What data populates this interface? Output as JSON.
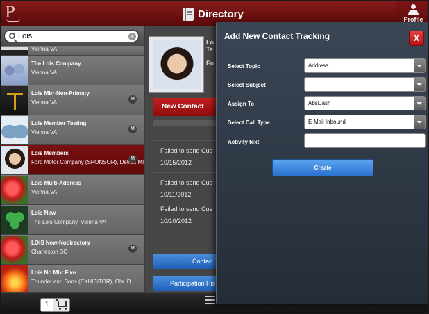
{
  "header": {
    "title": "Directory",
    "profile_label": "Profile",
    "logo": "P"
  },
  "search": {
    "value": "Lois"
  },
  "contacts": [
    {
      "name": "",
      "subtitle": "Vienna VA",
      "member_badge": ""
    },
    {
      "name": "The Lois Company",
      "subtitle": "Vienna VA",
      "member_badge": ""
    },
    {
      "name": "Lois Mbr-Non-Primary",
      "subtitle": "Vienna VA",
      "member_badge": "M"
    },
    {
      "name": "Lois Member Testing",
      "subtitle": "Vienna VA",
      "member_badge": "M"
    },
    {
      "name": "Lois Members",
      "subtitle": "Ford Motor Company (SPONSOR), Detroit MI",
      "member_badge": "M"
    },
    {
      "name": "Lois Multi-Address",
      "subtitle": "Vienna VA",
      "member_badge": ""
    },
    {
      "name": "Lois New",
      "subtitle": "The Lois Company, Vienna VA",
      "member_badge": ""
    },
    {
      "name": "LOIS New-Nodirectory",
      "subtitle": "Charleston SC",
      "member_badge": "M"
    },
    {
      "name": "Lois No Mbr Five",
      "subtitle": "Thunder and Sons (EXHIBITOR), Ola ID",
      "member_badge": ""
    }
  ],
  "detail": {
    "ghost_text_1": "Lo Te",
    "ghost_text_2": "Fo",
    "new_contact_label": "New Contact",
    "history": [
      {
        "message": "Failed to send Cus",
        "date": "10/15/2012"
      },
      {
        "message": "Failed to send Cus",
        "date": "10/11/2012"
      },
      {
        "message": "Failed to send Cus",
        "date": "10/10/2012"
      }
    ],
    "contact_button": "Contac",
    "participation_button": "Participation His"
  },
  "footer": {
    "cart_count": "1"
  },
  "modal": {
    "title": "Add New Contact Tracking",
    "close_label": "X",
    "fields": {
      "topic": {
        "label": "Select Topic",
        "value": "Address"
      },
      "subject": {
        "label": "Select Subject",
        "value": ""
      },
      "assign": {
        "label": "Assign To",
        "value": "AbsDash"
      },
      "call_type": {
        "label": "Select Call Type",
        "value": "E-Mail Inbound"
      },
      "activity": {
        "label": "Activity text",
        "value": ""
      }
    },
    "create_label": "Create"
  },
  "colors": {
    "accent_red": "#8a1c1c",
    "button_blue": "#2b71cf",
    "modal_bg": "#2f3846"
  }
}
